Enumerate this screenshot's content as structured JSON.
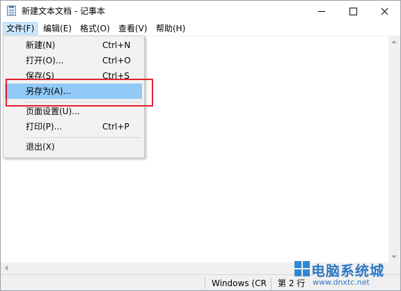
{
  "window": {
    "title": "新建文本文档 - 记事本"
  },
  "menubar": {
    "file": "文件(F)",
    "edit": "编辑(E)",
    "format": "格式(O)",
    "view": "查看(V)",
    "help": "帮助(H)"
  },
  "file_menu": {
    "items": [
      {
        "label": "新建(N)",
        "accel": "Ctrl+N"
      },
      {
        "label": "打开(O)...",
        "accel": "Ctrl+O"
      },
      {
        "label": "保存(S)",
        "accel": "Ctrl+S"
      },
      {
        "label": "另存为(A)...",
        "accel": ""
      },
      {
        "label": "页面设置(U)...",
        "accel": ""
      },
      {
        "label": "打印(P)...",
        "accel": "Ctrl+P"
      },
      {
        "label": "退出(X)",
        "accel": ""
      }
    ],
    "highlighted": "另存为(A)..."
  },
  "statusbar": {
    "encoding": "Windows (CR",
    "position": "第 2 行"
  },
  "watermark": {
    "name": "电脑系统城",
    "url": "www.dnxtc.net"
  },
  "colors": {
    "highlight": "#91c9f7",
    "callout": "#e0202a",
    "menu_open": "#cce8ff"
  }
}
